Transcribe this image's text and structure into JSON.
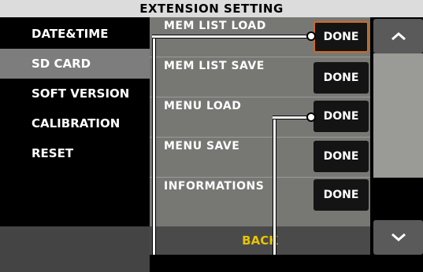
{
  "window": {
    "title": "EXTENSION SETTING"
  },
  "sidebar": {
    "items": [
      {
        "label": "DATE&TIME",
        "active": false
      },
      {
        "label": "SD CARD",
        "active": true
      },
      {
        "label": "SOFT VERSION",
        "active": false
      },
      {
        "label": "CALIBRATION",
        "active": false
      },
      {
        "label": "RESET",
        "active": false
      }
    ]
  },
  "main": {
    "rows": [
      {
        "label": "MEM LIST LOAD",
        "button": "DONE"
      },
      {
        "label": "MEM LIST SAVE",
        "button": "DONE"
      },
      {
        "label": "MENU LOAD",
        "button": "DONE"
      },
      {
        "label": "MENU SAVE",
        "button": "DONE"
      },
      {
        "label": "INFORMATIONS",
        "button": "DONE"
      }
    ]
  },
  "footer": {
    "back_label": "BACK"
  },
  "icons": {
    "scroll_up": "chevron-up-icon",
    "scroll_down": "chevron-down-icon"
  },
  "colors": {
    "accent_focus": "#d2691e",
    "back_text": "#e8c400",
    "panel": "#777874"
  }
}
